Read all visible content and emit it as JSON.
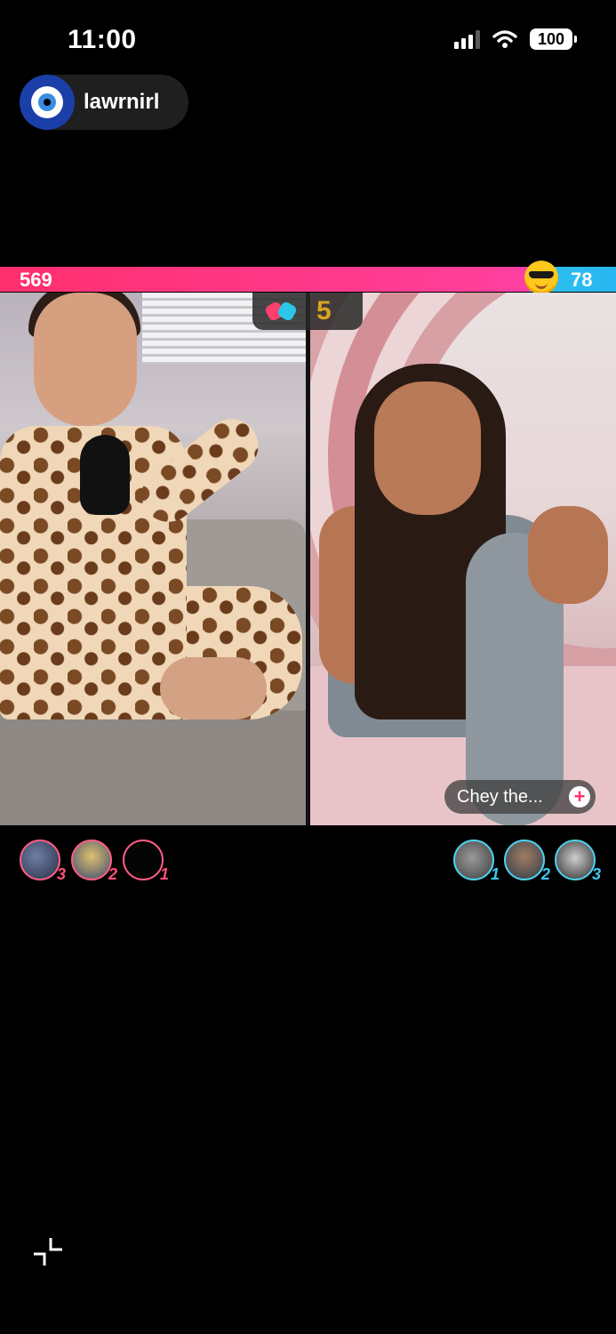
{
  "status_bar": {
    "time": "11:00",
    "battery": "100",
    "signal_icon": "signal-bars-icon",
    "wifi_icon": "wifi-icon"
  },
  "host": {
    "username": "lawrnirl",
    "avatar_icon": "evil-eye-avatar"
  },
  "battle": {
    "left_score": "569",
    "right_score": "78",
    "right_badge_icon": "sunglasses-emoji-icon",
    "match_icon": "boxing-gloves-icon",
    "match_count": "5",
    "colors": {
      "left": "#ff2f6e",
      "right": "#2fc1ef"
    }
  },
  "right_panel": {
    "name_pill": "Chey the...",
    "follow_icon": "plus-icon"
  },
  "left_gifters": [
    {
      "rank": "3"
    },
    {
      "rank": "2"
    },
    {
      "rank": "1"
    }
  ],
  "right_gifters": [
    {
      "rank": "1"
    },
    {
      "rank": "2"
    },
    {
      "rank": "3"
    }
  ],
  "controls": {
    "minimize_icon": "minimize-icon"
  }
}
